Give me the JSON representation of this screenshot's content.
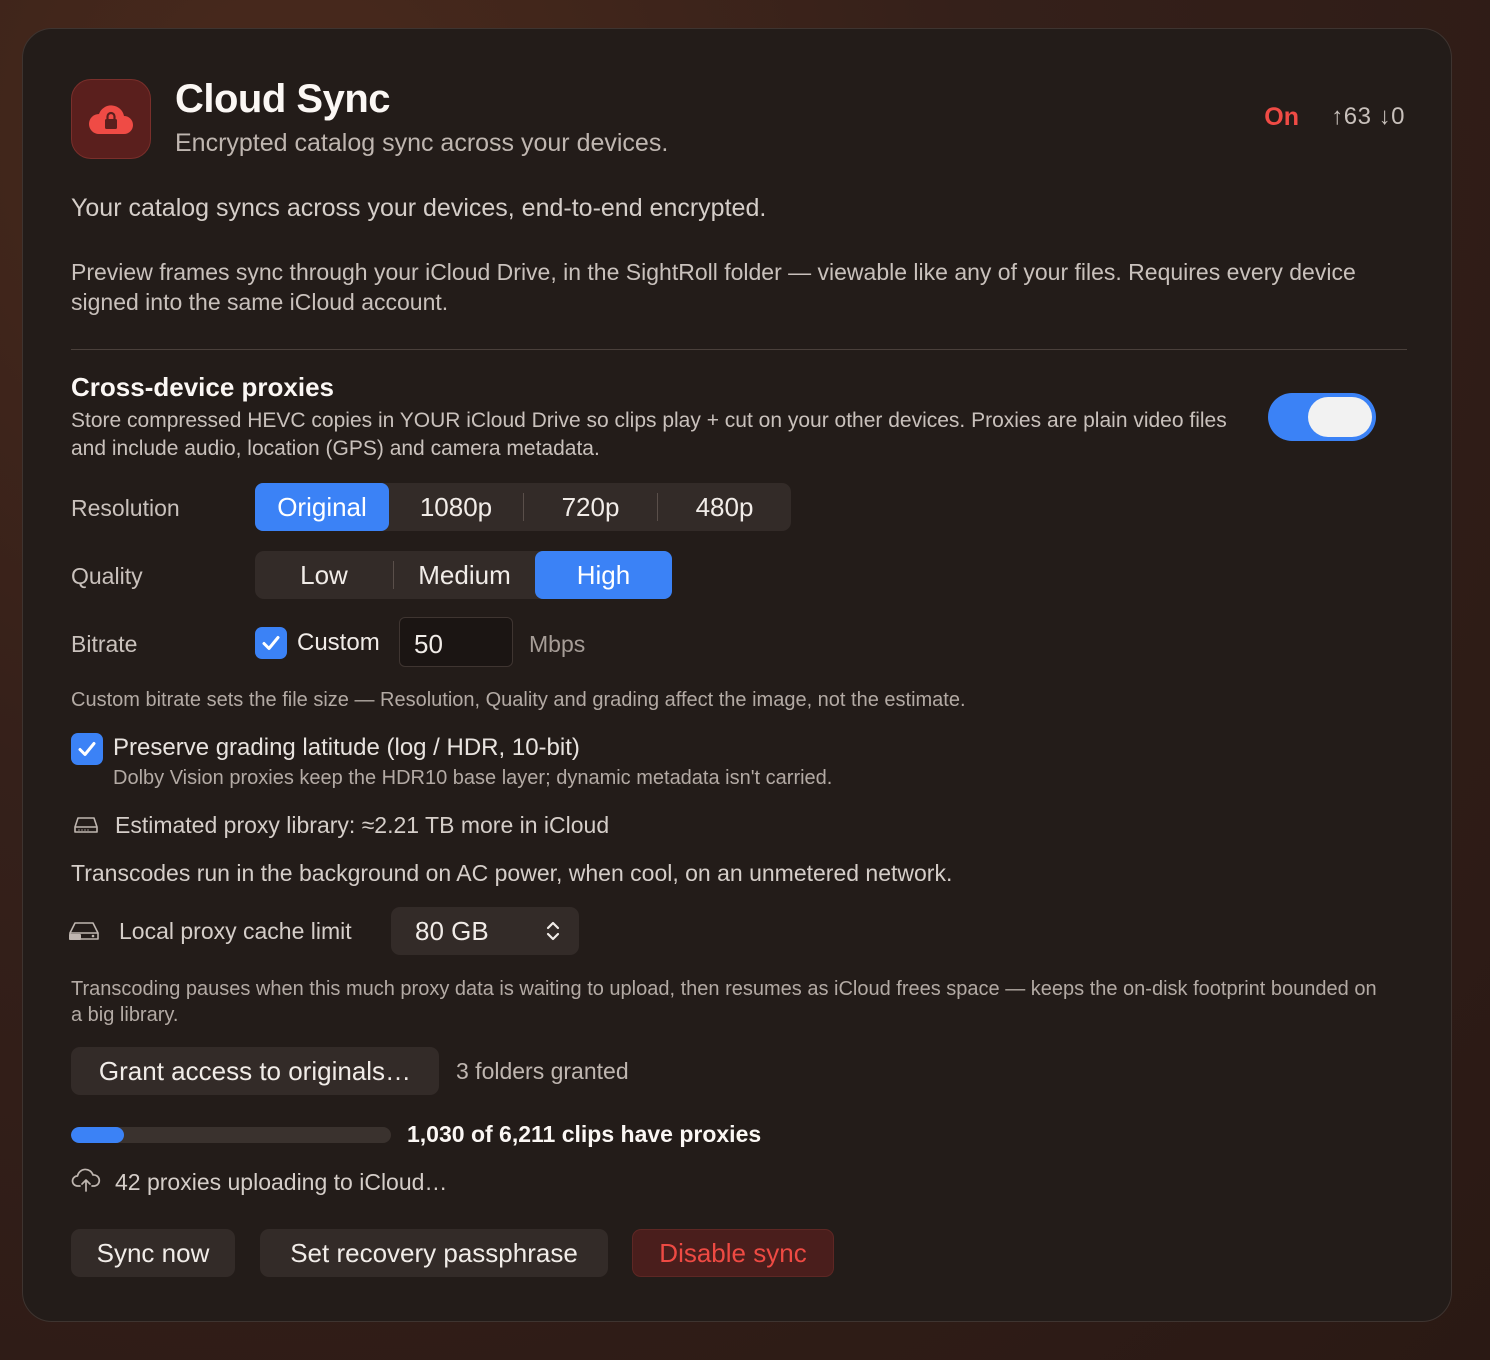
{
  "header": {
    "title": "Cloud Sync",
    "subtitle": "Encrypted catalog sync across your devices.",
    "status": "On",
    "counts": "↑63 ↓0"
  },
  "intro": "Your catalog syncs across your devices, end-to-end encrypted.",
  "description": "Preview frames sync through your iCloud Drive, in the SightRoll folder — viewable like any of your files. Requires every device signed into the same iCloud account.",
  "proxies": {
    "title": "Cross-device proxies",
    "description": "Store compressed HEVC copies in YOUR iCloud Drive so clips play + cut on your other devices. Proxies are plain video files and include audio, location (GPS) and camera metadata.",
    "enabled": true,
    "resolution": {
      "label": "Resolution",
      "options": [
        "Original",
        "1080p",
        "720p",
        "480p"
      ],
      "selected": "Original"
    },
    "quality": {
      "label": "Quality",
      "options": [
        "Low",
        "Medium",
        "High"
      ],
      "selected": "High"
    },
    "bitrate": {
      "label": "Bitrate",
      "custom_label": "Custom",
      "custom_checked": true,
      "value": "50",
      "unit": "Mbps"
    },
    "bitrate_note": "Custom bitrate sets the file size — Resolution, Quality and grading affect the image, not the estimate.",
    "preserve": {
      "label": "Preserve grading latitude (log / HDR, 10-bit)",
      "checked": true,
      "note": "Dolby Vision proxies keep the HDR10 base layer; dynamic metadata isn't carried."
    },
    "estimate": "Estimated proxy library: ≈2.21 TB more in iCloud",
    "transcode_note": "Transcodes run in the background on AC power, when cool, on an unmetered network.",
    "cache": {
      "label": "Local proxy cache limit",
      "value": "80 GB"
    },
    "cache_note": "Transcoding pauses when this much proxy data is waiting to upload, then resumes as iCloud frees space — keeps the on-disk footprint bounded on a big library.",
    "grant_button": "Grant access to originals…",
    "granted": "3 folders granted",
    "progress": {
      "done": 1030,
      "total": 6211,
      "text": "1,030 of 6,211 clips have proxies"
    },
    "uploading": "42 proxies uploading to iCloud…"
  },
  "actions": {
    "sync_now": "Sync now",
    "passphrase": "Set recovery passphrase",
    "disable": "Disable sync"
  },
  "colors": {
    "accent": "#3b82f6",
    "danger": "#ee4a43",
    "panel": "#231c19"
  },
  "icons": [
    "locked-cloud-icon",
    "drive-icon",
    "external-drive-icon",
    "cloud-upload-icon",
    "checkmark-icon",
    "chevron-updown-icon"
  ]
}
